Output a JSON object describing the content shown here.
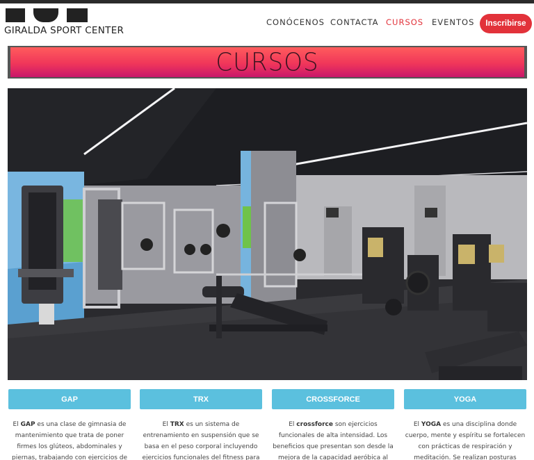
{
  "brand": {
    "name": "GIRALDA SPORT CENTER"
  },
  "nav": {
    "items": [
      "CONÓCENOS",
      "CONTACTA",
      "CURSOS",
      "EVENTOS"
    ],
    "active": "CURSOS",
    "cta": "Inscribirse"
  },
  "banner": {
    "title": "CURSOS"
  },
  "hero": {
    "icon": "gym-interior-photo"
  },
  "courses": [
    {
      "title": "GAP",
      "pre": "El ",
      "keyword": "GAP",
      "text": " es una clase de gimnasia de mantenimiento que trata de poner firmes los glúteos, abdominales y piernas, trabajando con ejercicios de poco peso y"
    },
    {
      "title": "TRX",
      "pre": "El ",
      "keyword": "TRX",
      "text": " es un sistema de entrenamiento en suspensión que se basa en el peso corporal incluyendo ejercicios funcionales del fitness para tonificar y aumentar de"
    },
    {
      "title": "CROSSFORCE",
      "pre": "El ",
      "keyword": "crossforce",
      "text": " son ejercicios funcionales de alta intensidad. Los beneficios que presentan son desde la mejora de la capacidad aeróbica al aumento de la"
    },
    {
      "title": "YOGA",
      "pre": "El ",
      "keyword": "YOGA",
      "text": " es una disciplina donde cuerpo, mente y espíritu se fortalecen con prácticas de respiración y meditación. Se realizan posturas estáticas para trabajar el"
    }
  ],
  "colors": {
    "accent": "#e2323a",
    "course_button": "#5bc0de",
    "banner_top": "#ff5c5c",
    "banner_bottom": "#c8176a"
  }
}
